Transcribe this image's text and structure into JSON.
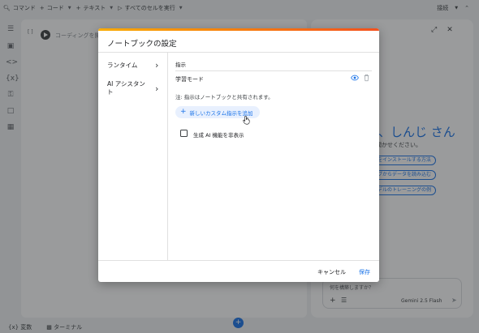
{
  "toolbar": {
    "command": "コマンド",
    "code": "コード",
    "text": "テキスト",
    "run_all": "すべてのセルを実行",
    "connect": "接続"
  },
  "cell": {
    "bracket": "[ ]",
    "placeholder": "コーディングを開"
  },
  "gemini": {
    "greeting": "く、しんじ さん",
    "subtitle": "聞かせください。",
    "chips": [
      "リをインストールする方法",
      "ブからデータを読み込む",
      "デルのトレーニングの例"
    ],
    "prompt_placeholder": "何を構築しますか？",
    "model": "Gemini 2.5 Flash"
  },
  "statusbar": {
    "variables": "変数",
    "terminal": "ターミナル"
  },
  "dialog": {
    "title": "ノートブックの設定",
    "nav": [
      {
        "label": "ランタイム"
      },
      {
        "label": "AI アシスタント"
      }
    ],
    "section_header": "指示",
    "instruction_name": "学習モード",
    "note": "注: 指示はノートブックと共有されます。",
    "add_button": "新しいカスタム指示を追加",
    "checkbox_label": "生成 AI 機能を非表示",
    "checkbox_checked": false,
    "cancel": "キャンセル",
    "save": "保存"
  },
  "colors": {
    "accent": "#1a73e8",
    "header_bar_start": "#f9ab00",
    "header_bar_end": "#f4511e"
  }
}
